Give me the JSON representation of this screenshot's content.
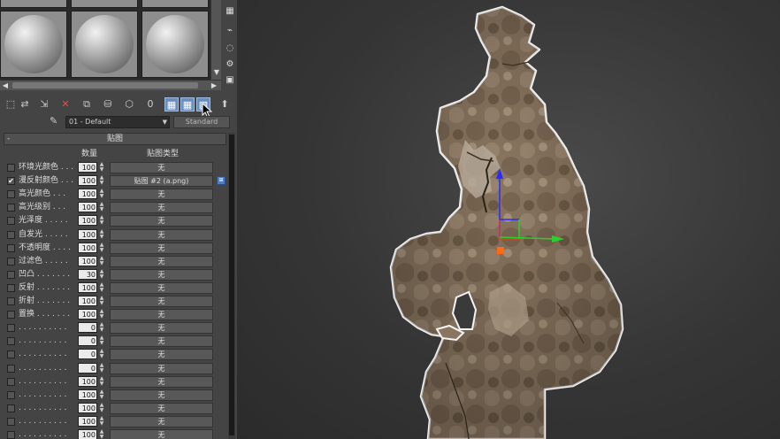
{
  "panel": {
    "slots_count": 6,
    "right_tools": [
      "render-icon",
      "checker-icon",
      "pipe-icon",
      "sample-icon",
      "options-icon",
      "video-icon",
      "make-preview-icon"
    ],
    "toolbar_icons": [
      {
        "name": "get-material-icon",
        "glyph": "⬚",
        "active": false
      },
      {
        "name": "put-to-scene-icon",
        "glyph": "⇄",
        "active": false
      },
      {
        "name": "assign-to-selection-icon",
        "glyph": "⇲",
        "active": false
      },
      {
        "name": "reset-map-icon",
        "glyph": "✕",
        "active": false
      },
      {
        "name": "make-copy-icon",
        "glyph": "⧉",
        "active": false
      },
      {
        "name": "make-unique-icon",
        "glyph": "⛁",
        "active": false
      },
      {
        "name": "put-to-library-icon",
        "glyph": "⬡",
        "active": false
      },
      {
        "name": "material-id-icon",
        "glyph": "0",
        "active": false
      },
      {
        "name": "show-shaded-map-icon",
        "glyph": "▦",
        "active": true
      },
      {
        "name": "show-hardware-map-icon",
        "glyph": "▦",
        "active": true
      },
      {
        "name": "show-end-result-icon",
        "glyph": "▧",
        "active": true
      },
      {
        "name": "go-to-parent-icon",
        "glyph": "⬆",
        "active": false
      }
    ],
    "material_name": "01 - Default",
    "material_type": "Standard",
    "rollout_title": "贴图",
    "column_amount": "数量",
    "column_map_type": "贴图类型",
    "rows": [
      {
        "checked": false,
        "label": "环境光颜色 . . .",
        "amount": "100",
        "map": "无"
      },
      {
        "checked": true,
        "label": "漫反射颜色 . . .",
        "amount": "100",
        "map": "贴图 #2 (a.png)",
        "tag": true
      },
      {
        "checked": false,
        "label": "高光颜色 . . .",
        "amount": "100",
        "map": "无"
      },
      {
        "checked": false,
        "label": "高光级别 . . .",
        "amount": "100",
        "map": "无"
      },
      {
        "checked": false,
        "label": "光泽度 . . . . .",
        "amount": "100",
        "map": "无"
      },
      {
        "checked": false,
        "label": "自发光 . . . . .",
        "amount": "100",
        "map": "无"
      },
      {
        "checked": false,
        "label": "不透明度 . . . .",
        "amount": "100",
        "map": "无"
      },
      {
        "checked": false,
        "label": "过滤色 . . . . .",
        "amount": "100",
        "map": "无"
      },
      {
        "checked": false,
        "label": "凹凸 . . . . . . .",
        "amount": "30",
        "map": "无"
      },
      {
        "checked": false,
        "label": "反射 . . . . . . .",
        "amount": "100",
        "map": "无"
      },
      {
        "checked": false,
        "label": "折射 . . . . . . .",
        "amount": "100",
        "map": "无"
      },
      {
        "checked": false,
        "label": "置换 . . . . . . .",
        "amount": "100",
        "map": "无"
      },
      {
        "checked": false,
        "label": ". . . . . . . . . .",
        "amount": "0",
        "map": "无"
      },
      {
        "checked": false,
        "label": ". . . . . . . . . .",
        "amount": "0",
        "map": "无"
      },
      {
        "checked": false,
        "label": ". . . . . . . . . .",
        "amount": "0",
        "map": "无"
      },
      {
        "checked": false,
        "label": ". . . . . . . . . .",
        "amount": "0",
        "map": "无"
      },
      {
        "checked": false,
        "label": ". . . . . . . . . .",
        "amount": "100",
        "map": "无"
      },
      {
        "checked": false,
        "label": ". . . . . . . . . .",
        "amount": "100",
        "map": "无"
      },
      {
        "checked": false,
        "label": ". . . . . . . . . .",
        "amount": "100",
        "map": "无"
      },
      {
        "checked": false,
        "label": ". . . . . . . . . .",
        "amount": "100",
        "map": "无"
      },
      {
        "checked": false,
        "label": ". . . . . . . . . .",
        "amount": "100",
        "map": "无"
      }
    ]
  },
  "viewport": {
    "gizmo_colors": {
      "x": "#2bd12b",
      "y": "#2b2bff",
      "z": "#ff3a1a"
    }
  }
}
